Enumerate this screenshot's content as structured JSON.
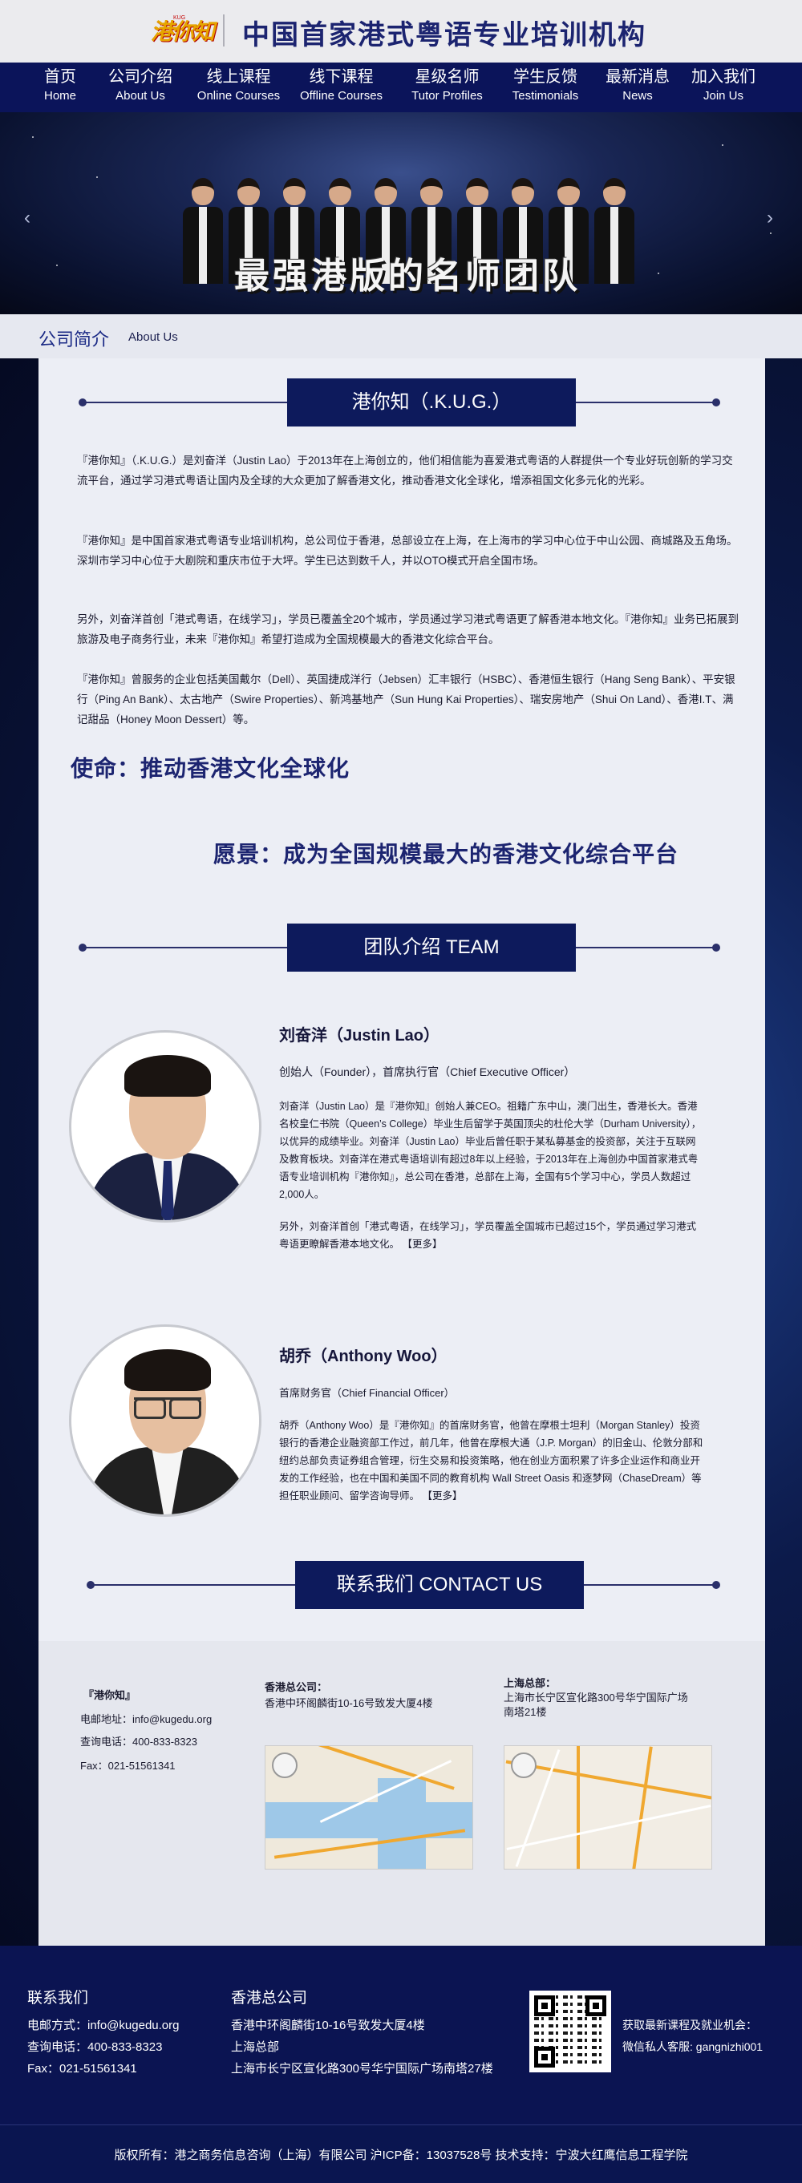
{
  "header": {
    "logo_text": "港你知",
    "logo_small": "KUG",
    "title": "中国首家港式粤语专业培训机构"
  },
  "nav": [
    {
      "cn": "首页",
      "en": "Home"
    },
    {
      "cn": "公司介绍",
      "en": "About Us"
    },
    {
      "cn": "线上课程",
      "en": "Online Courses"
    },
    {
      "cn": "线下课程",
      "en": "Offline Courses"
    },
    {
      "cn": "星级名师",
      "en": "Tutor Profiles"
    },
    {
      "cn": "学生反馈",
      "en": "Testimonials"
    },
    {
      "cn": "最新消息",
      "en": "News"
    },
    {
      "cn": "加入我们",
      "en": "Join Us"
    }
  ],
  "banner": {
    "text": "最强港版的名师团队",
    "prev_icon": "‹",
    "next_icon": "›"
  },
  "section": {
    "cn": "公司简介",
    "en": "About Us"
  },
  "about": {
    "heading": "港你知（.K.U.G.）",
    "p1": "『港你知』（.K.U.G.）是刘奋洋（Justin Lao）于2013年在上海创立的，他们相信能为喜爱港式粤语的人群提供一个专业好玩创新的学习交流平台，通过学习港式粤语让国内及全球的大众更加了解香港文化，推动香港文化全球化，增添祖国文化多元化的光彩。",
    "p2": "『港你知』是中国首家港式粤语专业培训机构，总公司位于香港，总部设立在上海，在上海市的学习中心位于中山公园、商城路及五角场。深圳市学习中心位于大剧院和重庆市位于大坪。学生已达到数千人，并以OTO模式开启全国市场。",
    "p3": "另外，刘奋洋首创「港式粤语，在线学习」，学员已覆盖全20个城市，学员通过学习港式粤语更了解香港本地文化。『港你知』业务已拓展到旅游及电子商务行业，未来『港你知』希望打造成为全国规模最大的香港文化综合平台。",
    "p4": "『港你知』曾服务的企业包括美国戴尔（Dell）、英国捷成洋行（Jebsen）汇丰银行（HSBC）、香港恒生银行（Hang Seng Bank）、平安银行（Ping An Bank）、太古地产（Swire Properties）、新鸿基地产（Sun Hung Kai Properties）、瑞安房地产（Shui On Land）、香港I.T、满记甜品（Honey Moon Dessert）等。",
    "mission": "使命：推动香港文化全球化",
    "vision": "愿景：成为全国规模最大的香港文化综合平台"
  },
  "team": {
    "heading": "团队介绍 TEAM",
    "members": [
      {
        "name": "刘奋洋（Justin Lao）",
        "role": "创始人（Founder），首席执行官（Chief Executive Officer）",
        "bio1": "刘奋洋（Justin Lao）是『港你知』创始人兼CEO。祖籍广东中山，澳门出生，香港长大。香港名校皇仁书院（Queen’s College）毕业生后留学于英国顶尖的杜伦大学（Durham University），以优异的成绩毕业。刘奋洋（Justin Lao）毕业后曾任职于某私募基金的投资部，关注于互联网及教育板块。刘奋洋在港式粤语培训有超过8年以上经验，于2013年在上海创办中国首家港式粤语专业培训机构『港你知』，总公司在香港，总部在上海，全国有5个学习中心，学员人数超过2,000人。",
        "bio2": "另外，刘奋洋首创「港式粤语，在线学习」，学员覆盖全国城市已超过15个，学员通过学习港式粤语更瞭解香港本地文化。",
        "more": "【更多】"
      },
      {
        "name": "胡乔（Anthony Woo）",
        "role": "首席财务官（Chief Financial Officer）",
        "bio1": "胡乔（Anthony Woo）是『港你知』的首席财务官，他曾在摩根士坦利（Morgan Stanley）投资银行的香港企业融资部工作过，前几年，他曾在摩根大通（J.P. Morgan）的旧金山、伦敦分部和纽约总部负责证券组合管理，衍生交易和投资策略，他在创业方面积累了许多企业运作和商业开发的工作经验，也在中国和美国不同的教育机构 Wall Street Oasis 和逐梦网（ChaseDream）等担任职业顾问、留学咨询导师。",
        "more": "【更多】"
      }
    ]
  },
  "contact": {
    "heading": "联系我们 CONTACT US",
    "brand": "『港你知』",
    "email": "电邮地址：info@kugedu.org",
    "phone": "查询电话：400-833-8323",
    "fax": "Fax：021-51561341",
    "hk_title": "香港总公司：",
    "hk_addr": "香港中环阁麟街10-16号致发大厦4楼",
    "sh_title": "上海总部：",
    "sh_addr": "上海市长宁区宣化路300号华宁国际广场南塔21楼"
  },
  "footer": {
    "contact_title": "联系我们",
    "email": "电邮方式：info@kugedu.org",
    "phone": "查询电话：400-833-8323",
    "fax": "Fax：021-51561341",
    "hk_title": "香港总公司",
    "hk_addr": "香港中环阁麟街10-16号致发大厦4楼",
    "sh_title": "上海总部",
    "sh_addr": "上海市长宁区宣化路300号华宁国际广场南塔27楼",
    "promo1": "获取最新课程及就业机会：",
    "promo2": "微信私人客服: gangnizhi001",
    "copyright": "版权所有：港之商务信息咨询（上海）有限公司  沪ICP备：13037528号    技术支持：宁波大红鹰信息工程学院"
  }
}
